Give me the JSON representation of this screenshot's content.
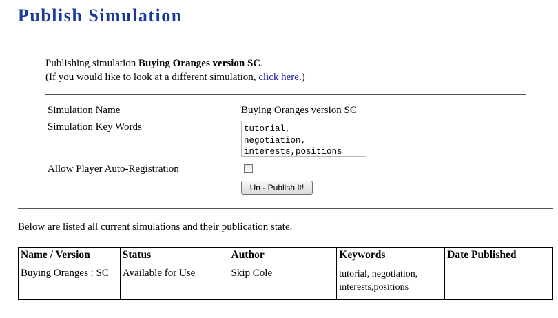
{
  "page": {
    "title": "Publish Simulation"
  },
  "intro": {
    "prefix": "Publishing simulation ",
    "sim_name": "Buying Oranges version SC",
    "suffix": ".",
    "line2_prefix": "(If you would like to look at a different simulation, ",
    "link_text": "click here",
    "line2_suffix": ".)"
  },
  "form": {
    "name_label": "Simulation Name",
    "name_value": "Buying Oranges version SC",
    "keywords_label": "Simulation Key Words",
    "keywords_value": "tutorial,\nnegotiation,\ninterests,positions",
    "autoreg_label": "Allow Player Auto-Registration",
    "autoreg_checked": false,
    "unpublish_label": "Un - Publish It!"
  },
  "list": {
    "caption": "Below are listed all current simulations and their publication state.",
    "headers": [
      "Name / Version",
      "Status",
      "Author",
      "Keywords",
      "Date Published"
    ],
    "rows": [
      {
        "name_version": "Buying Oranges : SC",
        "status": "Available for Use",
        "author": "Skip Cole",
        "keywords": "tutorial, negotiation, interests,positions",
        "date_published": ""
      }
    ]
  },
  "colors": {
    "title": "#1a3a9a",
    "link": "#1a1aa8"
  }
}
